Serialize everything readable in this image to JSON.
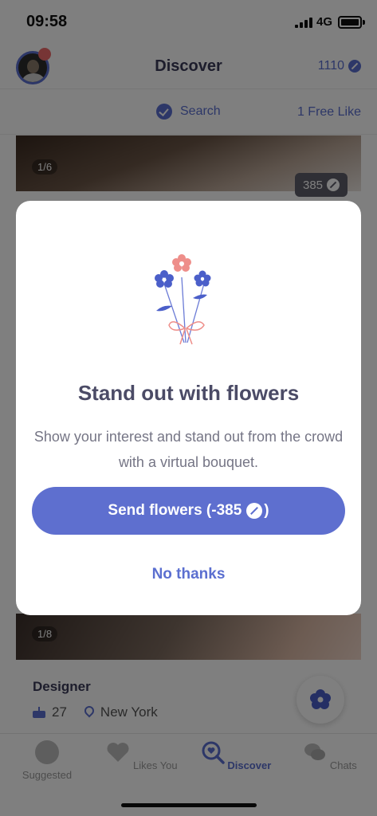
{
  "status_bar": {
    "time": "09:58",
    "network": "4G"
  },
  "header": {
    "title": "Discover",
    "coins": "1110"
  },
  "subbar": {
    "search_label": "Search",
    "free_like": "1 Free Like"
  },
  "profile_card": {
    "photo_counter_top": "1/6",
    "photo_counter_bottom": "1/8",
    "flowers_price": "385",
    "job": "Designer",
    "age": "27",
    "location": "New York"
  },
  "modal": {
    "heading": "Stand out with flowers",
    "description": "Show your interest and stand out from the crowd with a virtual bouquet.",
    "send_button": "Send flowers (-385",
    "send_button_suffix": ")",
    "dismiss_button": "No thanks"
  },
  "tabs": [
    {
      "label": "Suggested",
      "icon": "heart-circle-icon"
    },
    {
      "label": "Likes You",
      "icon": "heart-icon"
    },
    {
      "label": "Discover",
      "icon": "discover-search-icon",
      "active": true
    },
    {
      "label": "Chats",
      "icon": "chat-bubbles-icon"
    }
  ],
  "colors": {
    "accent": "#5e6fcf",
    "notification": "#ef6b6b",
    "flower_pink": "#ee8e8a"
  }
}
